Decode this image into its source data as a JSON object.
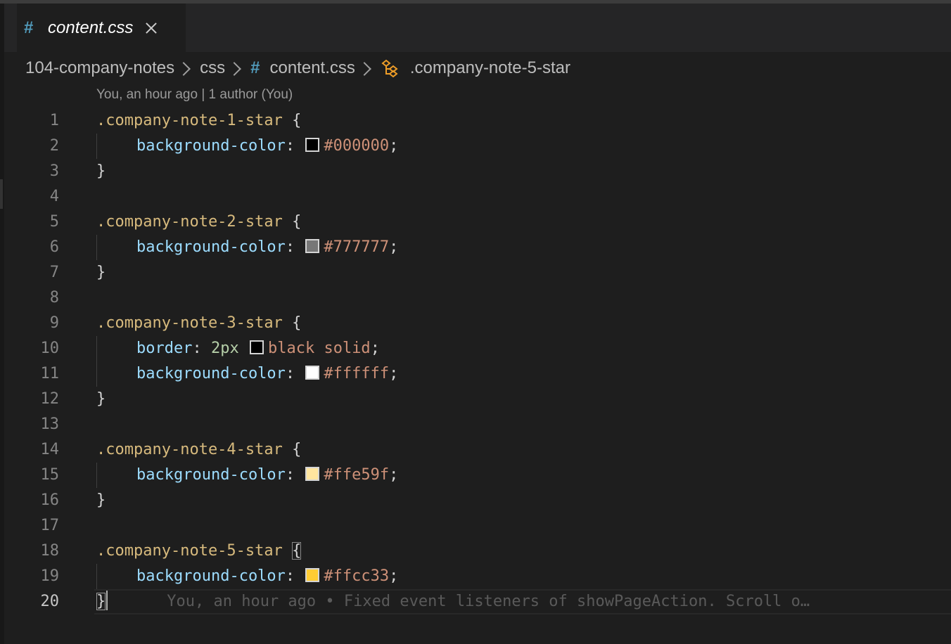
{
  "tab": {
    "icon": "css-hash-icon",
    "hash": "#",
    "title": "content.css"
  },
  "breadcrumb": {
    "items": [
      "104-company-notes",
      "css",
      "content.css",
      ".company-note-5-star"
    ],
    "hash": "#"
  },
  "blame_header": "You, an hour ago | 1 author (You)",
  "inline_blame": "You, an hour ago • Fixed event listeners of showPageAction. Scroll o…",
  "lines": [
    {
      "n": "1",
      "selector": ".company-note-1-star",
      "open": " {"
    },
    {
      "n": "2",
      "prop": "background-color",
      "colon": ": ",
      "value": "#000000",
      "semi": ";"
    },
    {
      "n": "3",
      "close": "}"
    },
    {
      "n": "4"
    },
    {
      "n": "5",
      "selector": ".company-note-2-star",
      "open": " {"
    },
    {
      "n": "6",
      "prop": "background-color",
      "colon": ": ",
      "value": "#777777",
      "semi": ";"
    },
    {
      "n": "7",
      "close": "}"
    },
    {
      "n": "8"
    },
    {
      "n": "9",
      "selector": ".company-note-3-star",
      "open": " {"
    },
    {
      "n": "10",
      "prop": "border",
      "colon": ": ",
      "num": "2px",
      "value": "black solid",
      "semi": ";"
    },
    {
      "n": "11",
      "prop": "background-color",
      "colon": ": ",
      "value": "#ffffff",
      "semi": ";"
    },
    {
      "n": "12",
      "close": "}"
    },
    {
      "n": "13"
    },
    {
      "n": "14",
      "selector": ".company-note-4-star",
      "open": " {"
    },
    {
      "n": "15",
      "prop": "background-color",
      "colon": ": ",
      "value": "#ffe59f",
      "semi": ";"
    },
    {
      "n": "16",
      "close": "}"
    },
    {
      "n": "17"
    },
    {
      "n": "18",
      "selector": ".company-note-5-star",
      "open": "{"
    },
    {
      "n": "19",
      "prop": "background-color",
      "colon": ": ",
      "value": "#ffcc33",
      "semi": ";"
    },
    {
      "n": "20",
      "close": "}"
    }
  ],
  "colors": {
    "editor_bg": "#1e1e1e",
    "selector": "#d7ba7d",
    "property": "#9cdcfe",
    "value": "#ce9178",
    "number": "#b5cea8",
    "swatch_1": "#000000",
    "swatch_2": "#777777",
    "swatch_3": "#000000",
    "swatch_4": "#ffffff",
    "swatch_5": "#ffe59f",
    "swatch_6": "#ffcc33"
  }
}
